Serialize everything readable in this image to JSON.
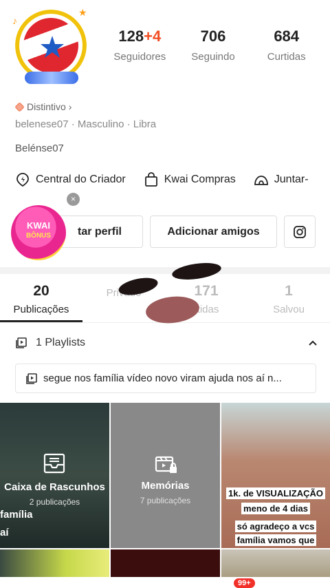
{
  "profile": {
    "stats": [
      {
        "value": "128",
        "extra": "+4",
        "label": "Seguidores"
      },
      {
        "value": "706",
        "extra": "",
        "label": "Seguindo"
      },
      {
        "value": "684",
        "extra": "",
        "label": "Curtidas"
      }
    ],
    "badge_label": "Distintivo",
    "meta": "belenese07 · Masculino · Libra",
    "bio": "Belénse07"
  },
  "shortcuts": [
    {
      "label": "Central do Criador",
      "icon": "lightning-pin-icon"
    },
    {
      "label": "Kwai Compras",
      "icon": "shopping-bag-icon"
    },
    {
      "label": "Juntar-",
      "icon": "tent-icon"
    }
  ],
  "actions": {
    "edit_label": "tar perfil",
    "add_friends_label": "Adicionar amigos",
    "instagram_icon": "instagram-icon"
  },
  "bonus": {
    "line1": "KWAI",
    "line2": "BÔNUS",
    "close": "×"
  },
  "tabs": [
    {
      "count": "20",
      "label": "Publicações",
      "active": true
    },
    {
      "count": "",
      "label": "Privado",
      "active": false
    },
    {
      "count": "171",
      "label": "rtidas",
      "active": false
    },
    {
      "count": "1",
      "label": "Salvou",
      "active": false
    }
  ],
  "playlists": {
    "header": "1 Playlists",
    "item": "segue nos família vídeo novo viram ajuda nos aí n..."
  },
  "grid": {
    "drafts_title": "Caixa de Rascunhos",
    "drafts_sub": "2 publicações",
    "drafts_overlay_1": "família",
    "drafts_overlay_2": "aí",
    "memories_title": "Memórias",
    "memories_sub": "7 publicações",
    "video_cap_1": "1k. de VISUALIZAÇÃO",
    "video_cap_2": "meno de 4 dias",
    "video_cap_3": "só agradeço a vcs",
    "video_cap_4": "família vamos que"
  },
  "bottom": {
    "notification_count": "99+"
  },
  "colors": {
    "accent": "#f04e23",
    "notification": "#f2302a",
    "bonus_pink": "#e9258f"
  }
}
